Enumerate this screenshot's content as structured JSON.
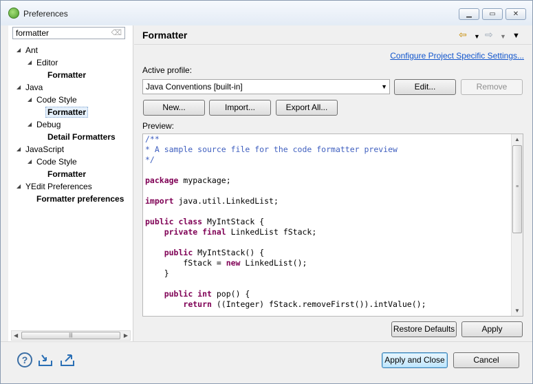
{
  "window": {
    "title": "Preferences",
    "controls": [
      "minimize",
      "restore",
      "close"
    ]
  },
  "filter": {
    "value": "formatter",
    "clear_icon": "clear-icon"
  },
  "tree": [
    {
      "label": "Ant",
      "level": 0,
      "expanded": true,
      "bold": false
    },
    {
      "label": "Editor",
      "level": 1,
      "expanded": true,
      "bold": false
    },
    {
      "label": "Formatter",
      "level": 2,
      "bold": true
    },
    {
      "label": "Java",
      "level": 0,
      "expanded": true,
      "bold": false
    },
    {
      "label": "Code Style",
      "level": 1,
      "expanded": true,
      "bold": false
    },
    {
      "label": "Formatter",
      "level": 2,
      "bold": true,
      "selected": true
    },
    {
      "label": "Debug",
      "level": 1,
      "expanded": true,
      "bold": false
    },
    {
      "label": "Detail Formatters",
      "level": 2,
      "bold": true
    },
    {
      "label": "JavaScript",
      "level": 0,
      "expanded": true,
      "bold": false
    },
    {
      "label": "Code Style",
      "level": 1,
      "expanded": true,
      "bold": false
    },
    {
      "label": "Formatter",
      "level": 2,
      "bold": true
    },
    {
      "label": "YEdit Preferences",
      "level": 0,
      "expanded": true,
      "bold": false
    },
    {
      "label": "Formatter preferences",
      "level": 1,
      "bold": true
    }
  ],
  "page": {
    "title": "Formatter",
    "configure_link": "Configure Project Specific Settings...",
    "active_profile_label": "Active profile:",
    "profile_value": "Java Conventions [built-in]",
    "edit_label": "Edit...",
    "remove_label": "Remove",
    "new_label": "New...",
    "import_label": "Import...",
    "export_all_label": "Export All...",
    "preview_label": "Preview:",
    "restore_defaults_label": "Restore Defaults",
    "apply_label": "Apply"
  },
  "preview_code": [
    {
      "t": "/**",
      "s": "c"
    },
    {
      "t": "* A sample source file for the code formatter preview",
      "s": "c"
    },
    {
      "t": "*/",
      "s": "c"
    },
    {
      "t": ""
    },
    {
      "parts": [
        {
          "t": "package",
          "s": "k"
        },
        {
          "t": " mypackage;"
        }
      ]
    },
    {
      "t": ""
    },
    {
      "parts": [
        {
          "t": "import",
          "s": "k"
        },
        {
          "t": " java.util.LinkedList;"
        }
      ]
    },
    {
      "t": ""
    },
    {
      "parts": [
        {
          "t": "public class",
          "s": "k"
        },
        {
          "t": " MyIntStack {"
        }
      ]
    },
    {
      "parts": [
        {
          "t": "    "
        },
        {
          "t": "private final",
          "s": "k"
        },
        {
          "t": " LinkedList fStack;"
        }
      ]
    },
    {
      "t": ""
    },
    {
      "parts": [
        {
          "t": "    "
        },
        {
          "t": "public",
          "s": "k"
        },
        {
          "t": " MyIntStack() {"
        }
      ]
    },
    {
      "parts": [
        {
          "t": "        fStack = "
        },
        {
          "t": "new",
          "s": "k"
        },
        {
          "t": " LinkedList();"
        }
      ]
    },
    {
      "t": "    }"
    },
    {
      "t": ""
    },
    {
      "parts": [
        {
          "t": "    "
        },
        {
          "t": "public int",
          "s": "k"
        },
        {
          "t": " pop() {"
        }
      ]
    },
    {
      "parts": [
        {
          "t": "        "
        },
        {
          "t": "return",
          "s": "k"
        },
        {
          "t": " ((Integer) fStack.removeFirst()).intValue();"
        }
      ]
    }
  ],
  "footer": {
    "apply_close_label": "Apply and Close",
    "cancel_label": "Cancel",
    "icons": [
      "help-icon",
      "import-icon",
      "export-icon"
    ]
  },
  "nav_icons": [
    "back-icon",
    "back-menu-icon",
    "forward-icon",
    "forward-menu-icon",
    "view-menu-icon"
  ]
}
